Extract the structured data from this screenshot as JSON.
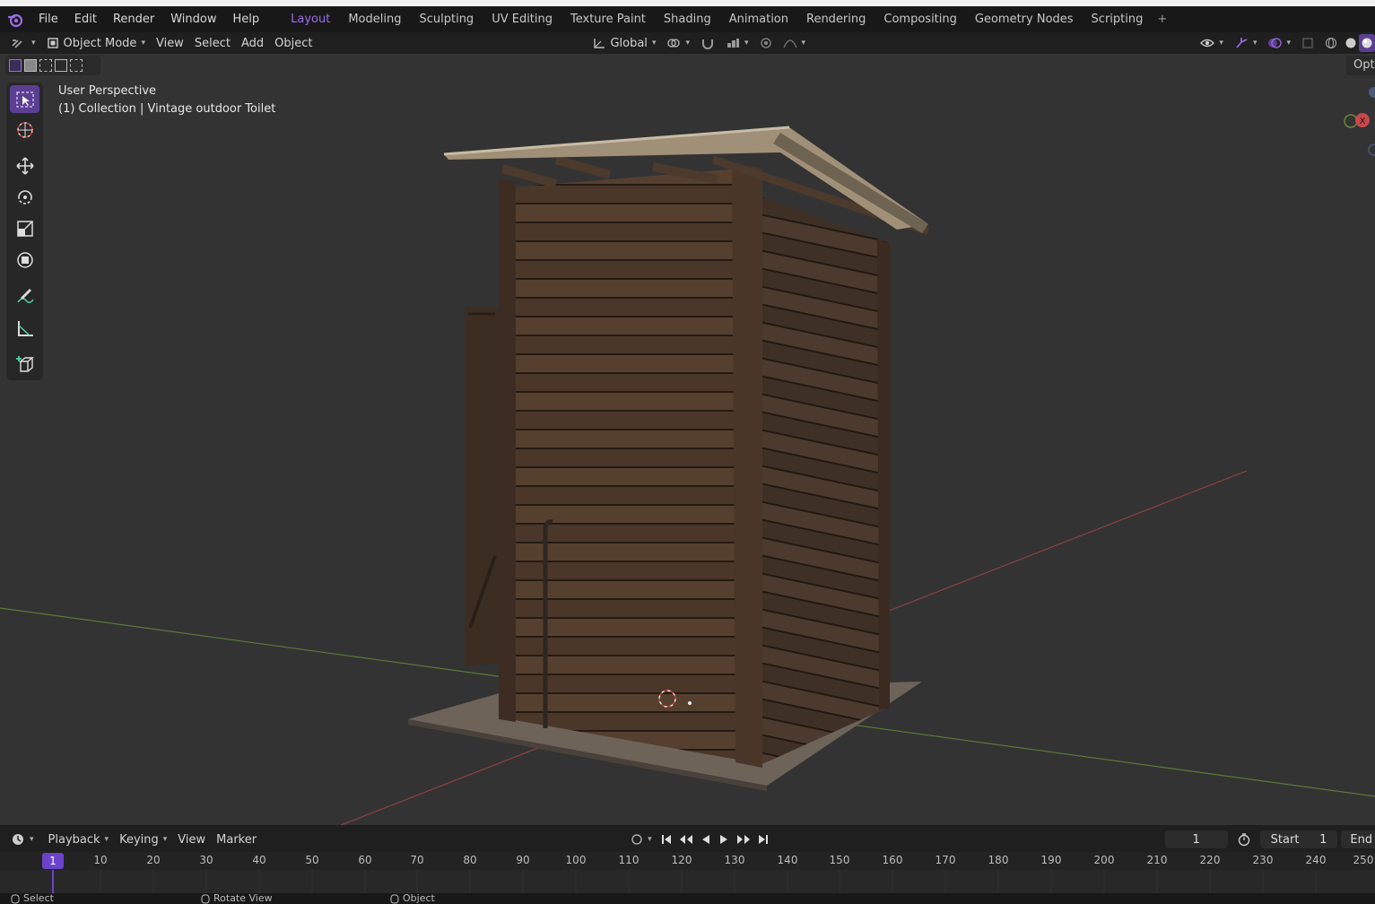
{
  "menubar": {
    "items": [
      "File",
      "Edit",
      "Render",
      "Window",
      "Help"
    ],
    "workspaces": [
      "Layout",
      "Modeling",
      "Sculpting",
      "UV Editing",
      "Texture Paint",
      "Shading",
      "Animation",
      "Rendering",
      "Compositing",
      "Geometry Nodes",
      "Scripting"
    ],
    "active_workspace": "Layout",
    "add_tab": "+"
  },
  "header": {
    "mode": "Object Mode",
    "menus": [
      "View",
      "Select",
      "Add",
      "Object"
    ],
    "orientation": "Global"
  },
  "viewport": {
    "perspective": "User Perspective",
    "collection": "(1) Collection | Vintage outdoor Toilet",
    "options_label": "Opt",
    "gizmo_x": "X"
  },
  "tools": [
    "select-box-icon",
    "cursor-icon",
    "move-icon",
    "rotate-icon",
    "scale-icon",
    "transform-icon",
    "annotate-icon",
    "measure-icon",
    "add-cube-icon"
  ],
  "timeline": {
    "menus": [
      "Playback",
      "Keying",
      "View",
      "Marker"
    ],
    "current_frame": "1",
    "start_label": "Start",
    "start_value": "1",
    "end_label": "End",
    "ruler_marker": "1",
    "ticks": [
      "10",
      "20",
      "30",
      "40",
      "50",
      "60",
      "70",
      "80",
      "90",
      "100",
      "110",
      "120",
      "130",
      "140",
      "150",
      "160",
      "170",
      "180",
      "190",
      "200",
      "210",
      "220",
      "230",
      "240",
      "250"
    ]
  },
  "statusbar": {
    "select": "Select",
    "rotate": "Rotate View",
    "object": "Object"
  },
  "colors": {
    "accent": "#9d6be8",
    "viewport_bg": "#333333",
    "x_axis": "#9a4646",
    "y_axis": "#6a8a3a"
  }
}
